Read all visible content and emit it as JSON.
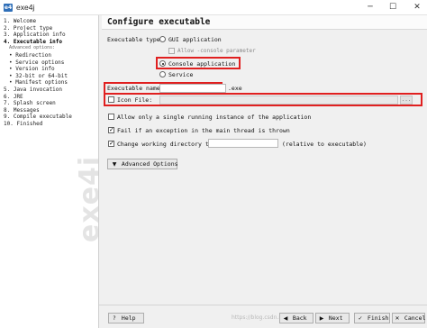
{
  "window": {
    "app_icon_text": "e4",
    "title": "exe4j",
    "minimize_glyph": "─",
    "maximize_glyph": "☐",
    "close_glyph": "✕"
  },
  "sidebar": {
    "steps": [
      {
        "label": "1. Welcome"
      },
      {
        "label": "2. Project type"
      },
      {
        "label": "3. Application info"
      },
      {
        "label": "4. Executable info"
      },
      {
        "label": "Advanced options:"
      },
      {
        "label": "• Redirection"
      },
      {
        "label": "• Service options"
      },
      {
        "label": "• Version info"
      },
      {
        "label": "• 32-bit or 64-bit"
      },
      {
        "label": "• Manifest options"
      },
      {
        "label": "5. Java invocation"
      },
      {
        "label": "6. JRE"
      },
      {
        "label": "7. Splash screen"
      },
      {
        "label": "8. Messages"
      },
      {
        "label": "9. Compile executable"
      },
      {
        "label": "10. Finished"
      }
    ],
    "watermark": "exe4j"
  },
  "page": {
    "heading": "Configure executable"
  },
  "form": {
    "executable_type_label": "Executable type:",
    "gui_option": "GUI application",
    "allow_console_label": "Allow -console parameter",
    "console_option": "Console application",
    "service_option": "Service",
    "executable_name_label": "Executable name:",
    "executable_name_value": "",
    "exe_suffix": ".exe",
    "icon_file_label": "Icon File:",
    "icon_file_value": "",
    "browse_label": "...",
    "single_instance_label": "Allow only a single running instance of the application",
    "fail_exception_label": "Fail if an exception in the main thread is thrown",
    "change_dir_label": "Change working directory to:",
    "change_dir_value": "",
    "relative_label": "(relative to executable)",
    "advanced_options_button": "Advanced Options",
    "advanced_options_icon": "▼"
  },
  "bottom": {
    "help": {
      "icon": "?",
      "label": "Help"
    },
    "back": {
      "icon": "◀",
      "label": "Back"
    },
    "next": {
      "icon": "▶",
      "label": "Next"
    },
    "finish": {
      "icon": "✓",
      "label": "Finish"
    },
    "cancel": {
      "icon": "✕",
      "label": "Cancel"
    },
    "watermark_url": "https://blog.csdn.net/..."
  },
  "colors": {
    "highlight_box": "#e02020",
    "app_icon": "#2f6fb8"
  }
}
